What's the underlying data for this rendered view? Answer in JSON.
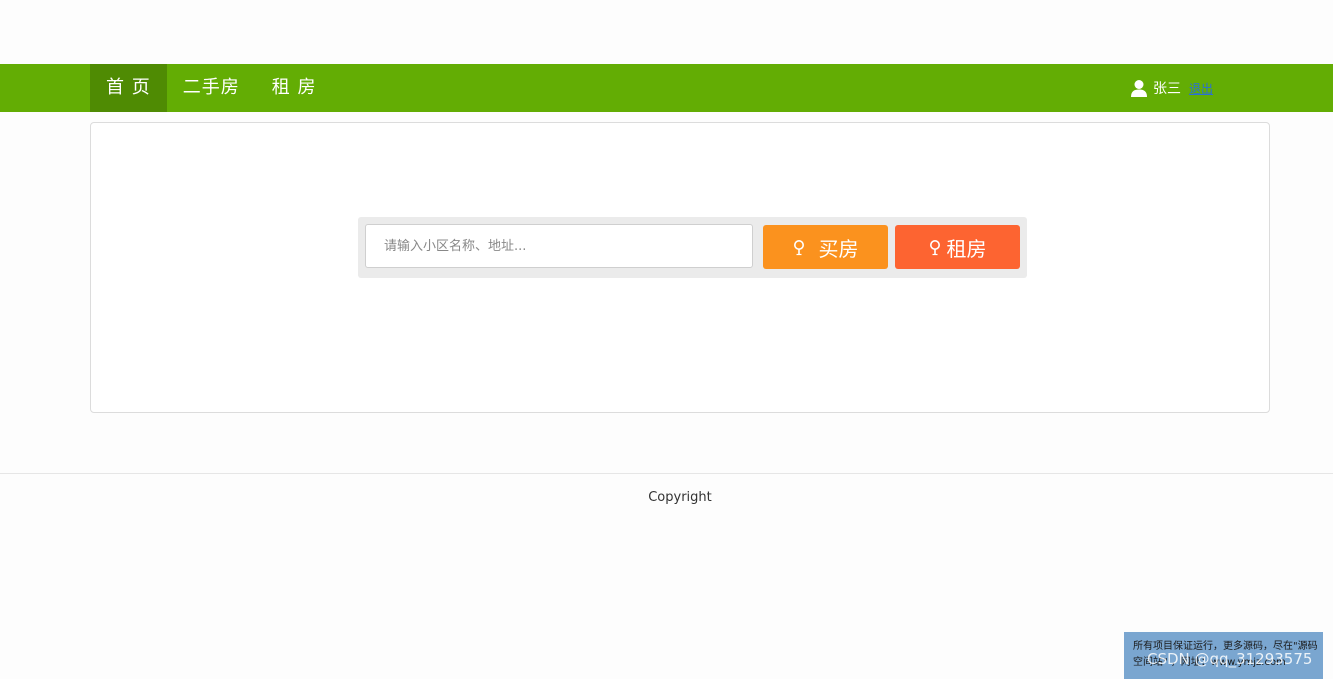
{
  "nav": {
    "items": [
      {
        "label": "首 页",
        "active": true
      },
      {
        "label": "二手房",
        "active": false
      },
      {
        "label": "租 房",
        "active": false
      }
    ]
  },
  "user": {
    "name": "张三",
    "logout": "退出"
  },
  "search": {
    "placeholder": "请输入小区名称、地址...",
    "buy_label": "买房",
    "rent_label": "租房"
  },
  "footer": {
    "copyright": "Copyright"
  },
  "ad": {
    "line1": "所有项目保证运行，更多源码，尽在\"源码",
    "line2": "空间站\" ，网址：www.ymjz.com"
  },
  "watermark": "CSDN @qq_31293575",
  "colors": {
    "topbar": "#63ad04",
    "nav_active": "#4f8b03",
    "buy_button": "#fb921e",
    "rent_button": "#fd6431"
  },
  "icons": {
    "user": "user-icon",
    "search": "map-pin-icon"
  }
}
